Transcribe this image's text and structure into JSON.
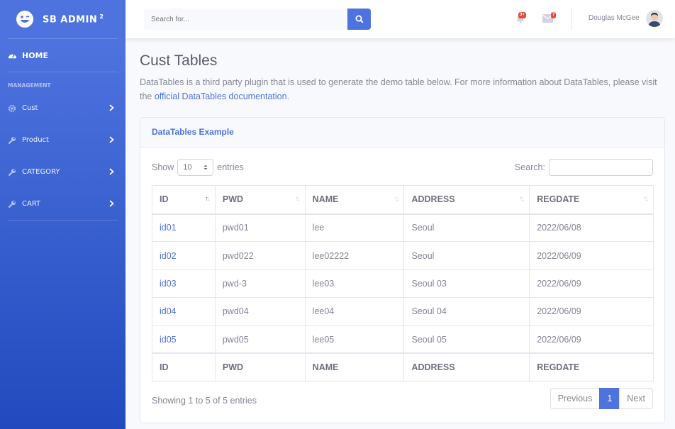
{
  "sidebar": {
    "brand": "SB ADMIN",
    "brand_sup": "2",
    "home": "HOME",
    "heading": "MANAGEMENT",
    "items": [
      {
        "label": "Cust",
        "icon": "gear-icon"
      },
      {
        "label": "Product",
        "icon": "wrench-icon"
      },
      {
        "label": "CATEGORY",
        "icon": "wrench-icon"
      },
      {
        "label": "CART",
        "icon": "wrench-icon"
      }
    ]
  },
  "topbar": {
    "search_placeholder": "Search for...",
    "alerts_badge": "3+",
    "messages_badge": "7",
    "user_name": "Douglas McGee"
  },
  "page": {
    "title": "Cust Tables",
    "description": "DataTables is a third party plugin that is used to generate the demo table below. For more information about DataTables, please visit the ",
    "link_text": "official DataTables documentation",
    "description_end": "."
  },
  "card": {
    "title": "DataTables Example",
    "show_label": "Show",
    "entries_value": "10",
    "entries_label": "entries",
    "search_label": "Search:",
    "columns": [
      "ID",
      "PWD",
      "NAME",
      "ADDRESS",
      "REGDATE"
    ],
    "rows": [
      [
        "id01",
        "pwd01",
        "lee",
        "Seoul",
        "2022/06/08"
      ],
      [
        "id02",
        "pwd022",
        "lee02222",
        "Seoul",
        "2022/06/09"
      ],
      [
        "id03",
        "pwd-3",
        "lee03",
        "Seoul 03",
        "2022/06/09"
      ],
      [
        "id04",
        "pwd04",
        "lee04",
        "Seoul 04",
        "2022/06/09"
      ],
      [
        "id05",
        "pwd05",
        "lee05",
        "Seoul 05",
        "2022/06/09"
      ]
    ],
    "info": "Showing 1 to 5 of 5 entries",
    "pager": {
      "previous": "Previous",
      "current": "1",
      "next": "Next"
    }
  },
  "colors": {
    "primary": "#4e73df",
    "danger": "#e74a3b",
    "text": "#858796"
  }
}
